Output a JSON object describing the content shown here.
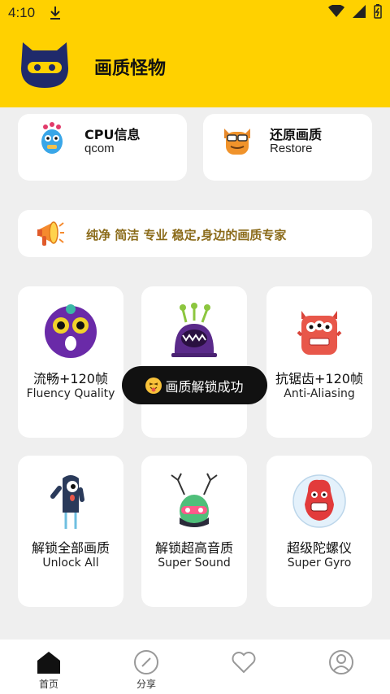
{
  "status_bar": {
    "time": "4:10"
  },
  "header": {
    "title": "画质怪物"
  },
  "info_cards": [
    {
      "title": "CPU信息",
      "subtitle": "qcom"
    },
    {
      "title": "还原画质",
      "subtitle": "Restore"
    }
  ],
  "banner": {
    "text": "纯净 简洁 专业 稳定,身边的画质专家"
  },
  "features": [
    {
      "title": "流畅+120帧",
      "subtitle": "Fluency Quality"
    },
    {
      "title": "",
      "subtitle": ""
    },
    {
      "title": "抗锯齿+120帧",
      "subtitle": "Anti-Aliasing"
    },
    {
      "title": "解锁全部画质",
      "subtitle": "Unlock All"
    },
    {
      "title": "解锁超高音质",
      "subtitle": "Super Sound"
    },
    {
      "title": "超级陀螺仪",
      "subtitle": "Super Gyro"
    }
  ],
  "toast": {
    "text": "画质解锁成功"
  },
  "bottom_nav": [
    {
      "label": "首页",
      "icon": "home-icon"
    },
    {
      "label": "分享",
      "icon": "compass-icon"
    },
    {
      "label": "",
      "icon": "heart-icon"
    },
    {
      "label": "",
      "icon": "user-icon"
    }
  ],
  "colors": {
    "brand_yellow": "#ffd100",
    "banner_text": "#8b6b1a",
    "toast_bg": "#111111"
  }
}
